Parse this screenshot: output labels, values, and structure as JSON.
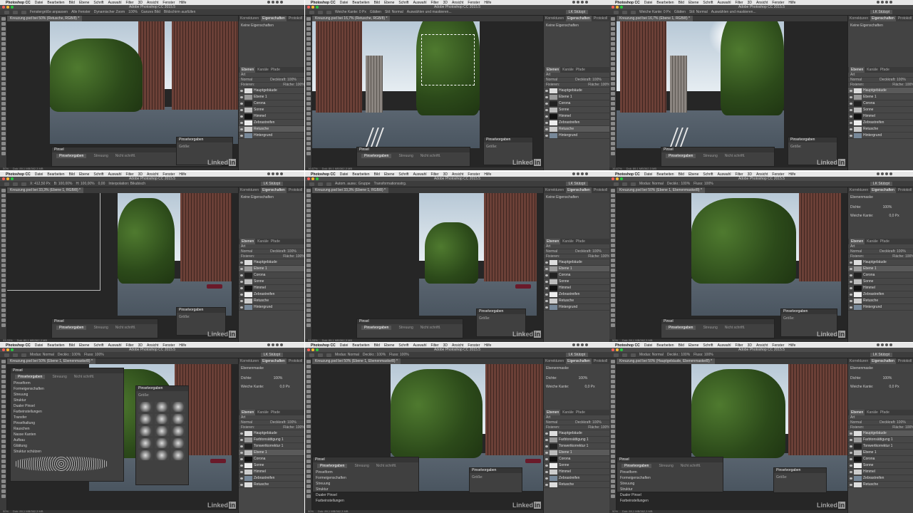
{
  "menu": {
    "app": "Photoshop CC",
    "items": [
      "Datei",
      "Bearbeiten",
      "Bild",
      "Ebene",
      "Schrift",
      "Auswahl",
      "Filter",
      "3D",
      "Ansicht",
      "Fenster",
      "Hilfe"
    ]
  },
  "window_title": "Adobe Photoshop CC 2015.5",
  "panel_tabs": [
    "Korrekturen",
    "Eigenschaften",
    "Protokoll"
  ],
  "layers_tabs": [
    "Ebenen",
    "Kanäle",
    "Pfade"
  ],
  "properties_empty": "Keine Eigenschaften",
  "layers": {
    "set_a": [
      "Hauptgebäude",
      "Ebene 1",
      "Corona",
      "Sonne",
      "Himmel",
      "Zebrastreifen",
      "Retusche",
      "Hintergrund"
    ],
    "set_b": [
      "Hauptgebäude",
      "Farbtonsättigung 1",
      "Tonwertkorrektur 1",
      "Ebene 1",
      "Corona",
      "Sonne",
      "Himmel",
      "Zebrastreifen",
      "Retusche"
    ]
  },
  "layer_opts": {
    "mode": "Normal",
    "opacity": "Deckkraft: 100%",
    "fill": "Fläche: 100%",
    "lock": "Fixieren:",
    "kind": "Art"
  },
  "brush": {
    "panel_title": "Pinsel",
    "tabs": [
      "Pinselvorgaben",
      "Streuung",
      "Nicht schriftl."
    ],
    "presets_title": "Pinselvorgaben",
    "size_label": "Größe:",
    "props": [
      "Pinselform",
      "Formeigenschaften",
      "Streuung",
      "Struktur",
      "Dualer Pinsel",
      "Farbeinstellungen",
      "Transfer",
      "Pinselhaltung",
      "Rauschen",
      "Nasse Kanten",
      "Aufbau",
      "Glättung",
      "Struktur schützen"
    ]
  },
  "mask": {
    "title": "Ebenenmaske",
    "density": "Dichte:",
    "density_val": "100%",
    "feather": "Weiche Kante:",
    "feather_val": "0,0 Px"
  },
  "tabs": [
    "Kreuzung.psd bei 50% (Retusche, RGB/8) *",
    "Kreuzung.psd bei 16,7% (Retusche, RGB/8) *",
    "Kreuzung.psd bei 16,7% (Ebene 1, RGB/8) *",
    "Kreuzung.psd bei 33,3% (Ebene 1, RGB/8) *",
    "Kreuzung.psd bei 33,3% (Ebene 1, RGB/8) *",
    "Kreuzung.psd bei 50% (Ebene 1, Ebenenmaske/8) *",
    "Kreuzung.psd bei 50% (Ebene 1, Ebenenmaske/8) *",
    "Kreuzung.psd bei 50% (Ebene 1, Ebenenmaske/8) *",
    "Kreuzung.psd bei 50% (Hauptgebäude, Ebenenmaske/8) *"
  ],
  "options": {
    "p1": [
      "Fenstergröße anpassen",
      "Alle Fenster",
      "Dynamischer Zoom",
      "100%",
      "Ganzes Bild",
      "Bildschirm ausfüllen"
    ],
    "p2": [
      "Weiche Kante: 0 Px",
      "Glätten",
      "Stil: Normal",
      "Auswählen und maskieren..."
    ],
    "p4": [
      "X: 412,50 Px",
      "B: 100,00%",
      "H: 100,00%",
      "0,00",
      "Interpolation: Bikubisch"
    ],
    "p5": [
      "Autom. ausw.: Gruppe",
      "Transformationsstrg."
    ],
    "p7": [
      "Modus: Normal",
      "Deckkr.: 100%",
      "Fluss: 100%"
    ],
    "workspace": "LK Stützpt"
  },
  "status": {
    "zoom_50": "50%",
    "zoom_16": "16,67%",
    "zoom_33": "33,33%",
    "doc": "Dok: 89,1 MB/362,3 MB"
  },
  "watermark": {
    "text": "Linked",
    "box": "in"
  },
  "colors": {
    "mac_red": "#ff5f57",
    "mac_yellow": "#febc2e",
    "mac_green": "#28c840"
  }
}
